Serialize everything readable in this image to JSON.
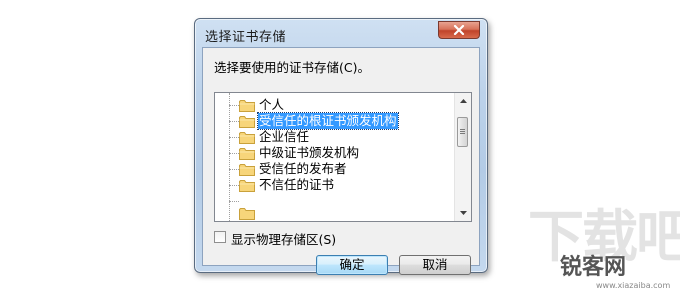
{
  "window": {
    "title": "选择证书存储",
    "close_icon": "close-icon"
  },
  "dialog": {
    "prompt": "选择要使用的证书存储(C)。",
    "tree": {
      "items": [
        {
          "label": "个人",
          "icon": "folder-icon",
          "selected": false
        },
        {
          "label": "受信任的根证书颁发机构",
          "icon": "folder-icon",
          "selected": true
        },
        {
          "label": "企业信任",
          "icon": "folder-icon",
          "selected": false
        },
        {
          "label": "中级证书颁发机构",
          "icon": "folder-icon",
          "selected": false
        },
        {
          "label": "受信任的发布者",
          "icon": "folder-icon",
          "selected": false
        },
        {
          "label": "不信任的证书",
          "icon": "folder-icon",
          "selected": false
        }
      ]
    },
    "show_physical_stores": {
      "label": "显示物理存储区(S)",
      "checked": false
    },
    "ok_label": "确定",
    "cancel_label": "取消"
  },
  "watermark": {
    "big_text": "下载吧",
    "brand": "锐客网",
    "url": "www.xiazaiba.com"
  },
  "colors": {
    "selection": "#3399ff",
    "window_frame": "#b3cbe6",
    "close_button": "#c0432a"
  }
}
